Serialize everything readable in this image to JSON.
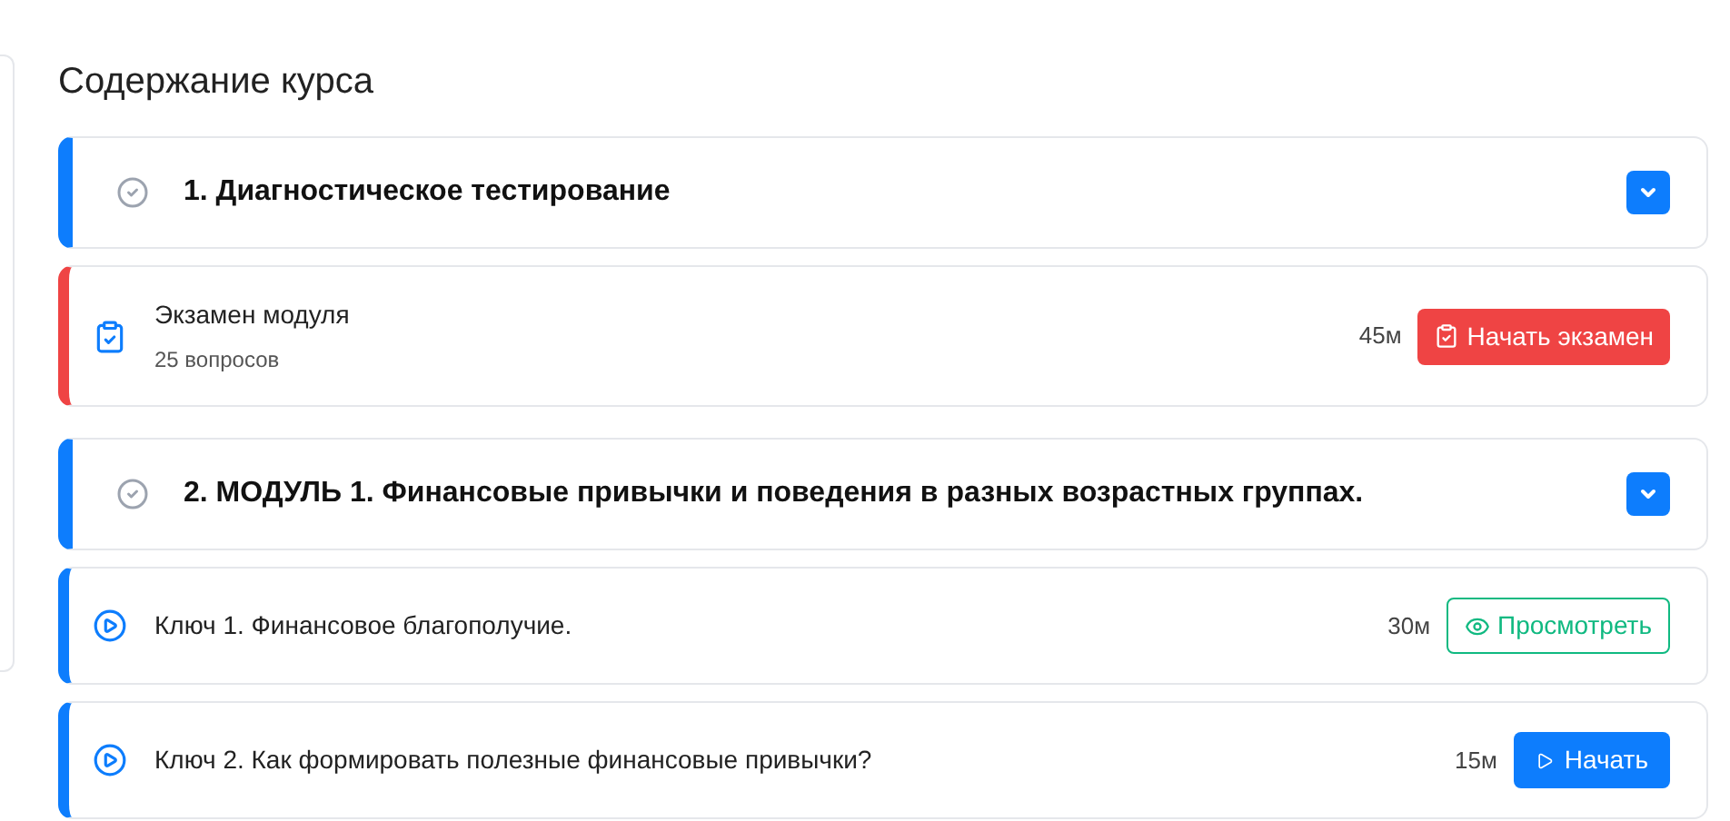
{
  "title": "Содержание курса",
  "sections": [
    {
      "number_title": "1. Диагностическое тестирование",
      "items": [
        {
          "kind": "exam",
          "title": "Экзамен модуля",
          "subtitle": "25 вопросов",
          "duration": "45м",
          "action": {
            "kind": "exam",
            "label": "Начать экзамен"
          }
        }
      ]
    },
    {
      "number_title": "2. МОДУЛЬ 1. Финансовые привычки и поведения в разных возрастных группах.",
      "items": [
        {
          "kind": "lesson",
          "title": "Ключ 1. Финансовое благополучие.",
          "duration": "30м",
          "action": {
            "kind": "view",
            "label": "Просмотреть"
          }
        },
        {
          "kind": "lesson",
          "title": "Ключ 2. Как формировать полезные финансовые привычки?",
          "duration": "15м",
          "action": {
            "kind": "start",
            "label": "Начать"
          }
        }
      ]
    }
  ]
}
